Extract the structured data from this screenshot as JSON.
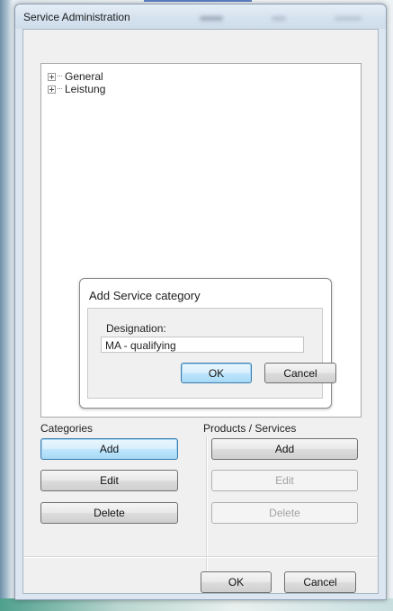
{
  "window": {
    "title": "Service Administration"
  },
  "tree": {
    "nodes": [
      {
        "label": "General"
      },
      {
        "label": "Leistung"
      }
    ]
  },
  "dialog": {
    "title": "Add Service category",
    "designation_label": "Designation:",
    "designation_value": "MA - qualifying",
    "ok_label": "OK",
    "cancel_label": "Cancel"
  },
  "categories": {
    "heading": "Categories",
    "add_label": "Add",
    "edit_label": "Edit",
    "delete_label": "Delete"
  },
  "products": {
    "heading": "Products / Services",
    "add_label": "Add",
    "edit_label": "Edit",
    "delete_label": "Delete"
  },
  "footer": {
    "ok_label": "OK",
    "cancel_label": "Cancel"
  }
}
